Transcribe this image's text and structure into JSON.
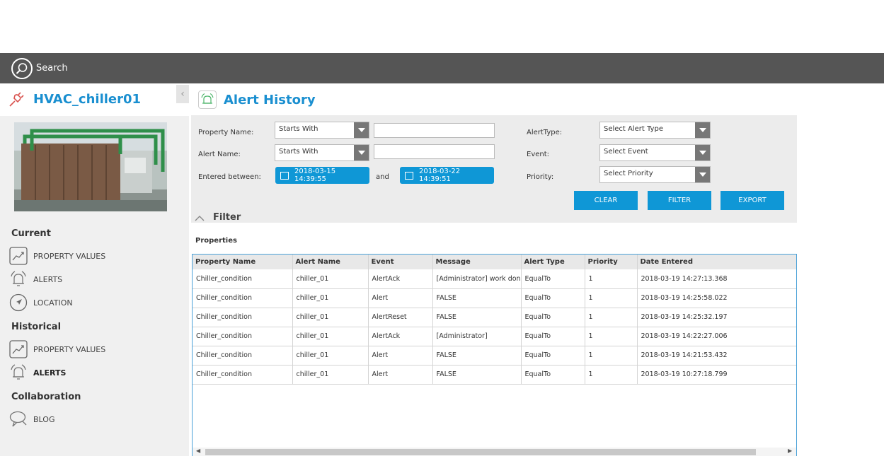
{
  "topbar": {
    "search_label": "Search"
  },
  "device": {
    "name": "HVAC_chiller01"
  },
  "nav": {
    "current_heading": "Current",
    "current_items": [
      {
        "label": "PROPERTY VALUES",
        "icon": "trend-chart-icon"
      },
      {
        "label": "ALERTS",
        "icon": "alarm-bell-icon"
      },
      {
        "label": "LOCATION",
        "icon": "navigation-arrow-icon"
      }
    ],
    "historical_heading": "Historical",
    "historical_items": [
      {
        "label": "PROPERTY VALUES",
        "icon": "trend-chart-icon"
      },
      {
        "label": "ALERTS",
        "icon": "alarm-bell-icon",
        "active": true
      }
    ],
    "collab_heading": "Collaboration",
    "collab_items": [
      {
        "label": "BLOG",
        "icon": "speech-bubble-icon"
      }
    ]
  },
  "main": {
    "title": "Alert History"
  },
  "filter": {
    "property_name_label": "Property Name:",
    "property_name_mode": "Starts With",
    "property_name_value": "",
    "alert_name_label": "Alert Name:",
    "alert_name_mode": "Starts With",
    "alert_name_value": "",
    "entered_between_label": "Entered between:",
    "date_from": "2018-03-15 14:39:55",
    "and_label": "and",
    "date_to": "2018-03-22 14:39:51",
    "alert_type_label": "AlertType:",
    "alert_type_value": "Select Alert Type",
    "event_label": "Event:",
    "event_value": "Select Event",
    "priority_label": "Priority:",
    "priority_value": "Select Priority",
    "clear_label": "CLEAR",
    "filter_label": "FILTER",
    "export_label": "EXPORT",
    "toggle_label": "Filter"
  },
  "properties_label": "Properties",
  "table": {
    "columns": [
      "Property Name",
      "Alert Name",
      "Event",
      "Message",
      "Alert Type",
      "Priority",
      "Date Entered"
    ],
    "rows": [
      [
        "Chiller_condition",
        "chiller_01",
        "AlertAck",
        "[Administrator] work done",
        "EqualTo",
        "1",
        "2018-03-19 14:27:13.368"
      ],
      [
        "Chiller_condition",
        "chiller_01",
        "Alert",
        "FALSE",
        "EqualTo",
        "1",
        "2018-03-19 14:25:58.022"
      ],
      [
        "Chiller_condition",
        "chiller_01",
        "AlertReset",
        "FALSE",
        "EqualTo",
        "1",
        "2018-03-19 14:25:32.197"
      ],
      [
        "Chiller_condition",
        "chiller_01",
        "AlertAck",
        "[Administrator]",
        "EqualTo",
        "1",
        "2018-03-19 14:22:27.006"
      ],
      [
        "Chiller_condition",
        "chiller_01",
        "Alert",
        "FALSE",
        "EqualTo",
        "1",
        "2018-03-19 14:21:53.432"
      ],
      [
        "Chiller_condition",
        "chiller_01",
        "Alert",
        "FALSE",
        "EqualTo",
        "1",
        "2018-03-19 10:27:18.799"
      ]
    ]
  },
  "colors": {
    "accent": "#0f97d6",
    "title": "#1a8fd0",
    "topbar": "#555555",
    "sidebar": "#f0f0f0"
  }
}
